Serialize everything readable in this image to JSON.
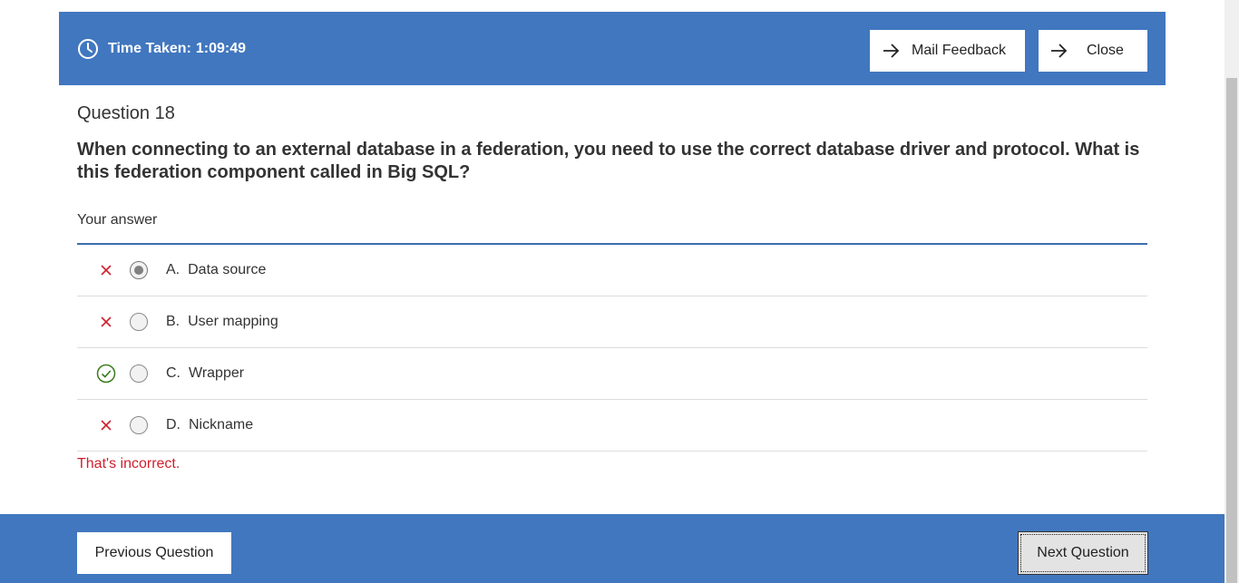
{
  "header": {
    "time_label": "Time Taken:",
    "time_value": "1:09:49",
    "mail_feedback_label": "Mail Feedback",
    "close_label": "Close"
  },
  "question": {
    "number_label": "Question 18",
    "text": "When connecting to an external database in a federation, you need to use the correct database driver and protocol. What is this federation component called in Big SQL?"
  },
  "answer": {
    "heading": "Your answer",
    "options": [
      {
        "letter": "A.",
        "text": "Data source",
        "status": "incorrect",
        "selected": true
      },
      {
        "letter": "B.",
        "text": "User mapping",
        "status": "incorrect",
        "selected": false
      },
      {
        "letter": "C.",
        "text": "Wrapper",
        "status": "correct",
        "selected": false
      },
      {
        "letter": "D.",
        "text": "Nickname",
        "status": "incorrect",
        "selected": false
      }
    ],
    "feedback": "That's incorrect."
  },
  "footer": {
    "previous_label": "Previous Question",
    "next_label": "Next Question"
  },
  "colors": {
    "header_bg": "#4177bf",
    "incorrect": "#d0202e",
    "correct": "#3a7a1e"
  }
}
